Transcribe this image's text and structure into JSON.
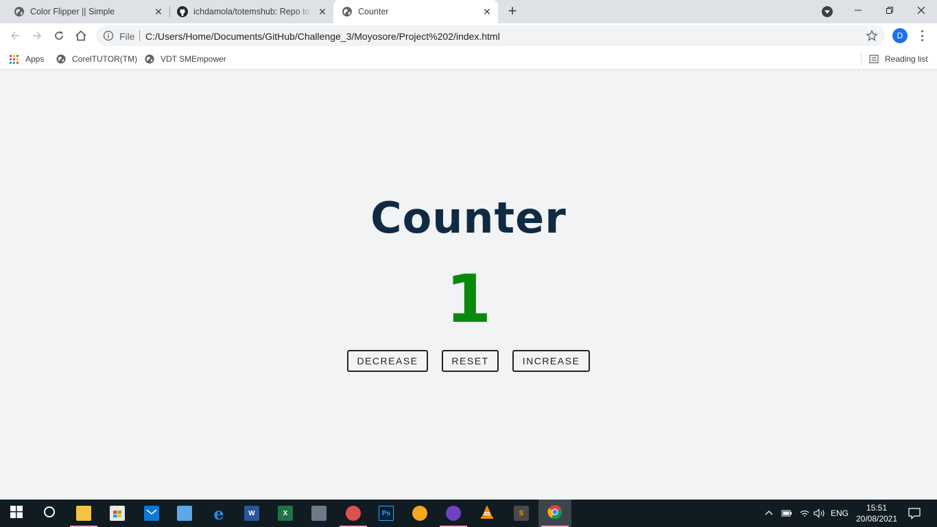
{
  "browser": {
    "tabs": [
      {
        "title": "Color Flipper || Simple",
        "active": false
      },
      {
        "title": "ichdamola/totemshub: Repo to track",
        "active": false
      },
      {
        "title": "Counter",
        "active": true
      }
    ],
    "new_tab_label": "+",
    "address": {
      "scheme_label": "File",
      "url": "C:/Users/Home/Documents/GitHub/Challenge_3/Moyosore/Project%202/index.html"
    },
    "profile_initial": "D",
    "bookmarks": [
      {
        "label": "Apps",
        "icon": "apps-grid-icon"
      },
      {
        "label": "CorelTUTOR(TM)",
        "icon": "globe-icon"
      },
      {
        "label": "VDT SMEmpower",
        "icon": "globe-icon"
      }
    ],
    "reading_list_label": "Reading list"
  },
  "page": {
    "title": "Counter",
    "count": "1",
    "count_color": "#0a8a0a",
    "buttons": {
      "decrease": "DECREASE",
      "reset": "RESET",
      "increase": "INCREASE"
    }
  },
  "taskbar": {
    "apps": [
      "start-icon",
      "cortana-icon",
      "file-explorer-icon",
      "store-icon",
      "mail-icon",
      "control-panel-icon",
      "edge-icon",
      "word-icon",
      "excel-icon",
      "network-icon",
      "paint-icon",
      "photoshop-icon",
      "brave-icon",
      "github-desktop-icon",
      "vlc-icon",
      "sublime-text-icon",
      "chrome-icon"
    ],
    "language": "ENG",
    "time": "15:51",
    "date": "20/08/2021"
  },
  "colors": {
    "title": "#102a43",
    "background": "#f1f3f5",
    "counter_positive": "#0a8a0a"
  }
}
